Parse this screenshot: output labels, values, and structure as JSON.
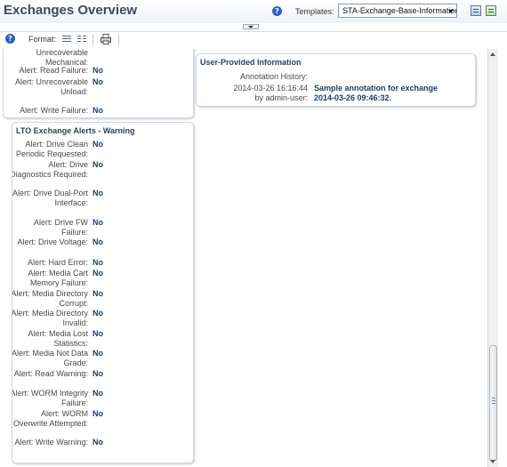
{
  "header": {
    "title": "Exchanges Overview",
    "templates_label": "Templates:",
    "template_value": "STA-Exchange-Base-Information",
    "help_glyph": "?"
  },
  "toolbar": {
    "help_glyph": "?",
    "format_label": "Format:"
  },
  "panels": {
    "top_left": {
      "rows": [
        {
          "label": "Unrecoverable Mechanical:",
          "value": ""
        },
        {
          "label": "Alert: Read Failure:",
          "value": "No"
        },
        {
          "label": "Alert: Unrecoverable Unload:",
          "value": "No"
        },
        {
          "label": "Alert: Write Failure:",
          "value": "No"
        }
      ]
    },
    "user_info": {
      "title": "User-Provided Information",
      "history_label": "Annotation History:",
      "entry_label": "2014-03-26 16:16:44 by admin-user:",
      "entry_value": "Sample annotation for exchange 2014-03-26 09:46:32."
    },
    "lto_warning": {
      "title": "LTO Exchange Alerts - Warning",
      "rows": [
        {
          "label": "Alert: Drive Clean Periodic Requested:",
          "value": "No"
        },
        {
          "label": "Alert: Drive Diagnostics Required:",
          "value": "No"
        },
        {
          "label": "Alert: Drive Dual-Port Interface:",
          "value": "No"
        },
        {
          "label": "Alert: Drive FW Failure:",
          "value": "No"
        },
        {
          "label": "Alert: Drive Voltage:",
          "value": "No"
        },
        {
          "label": "Alert: Hard Error:",
          "value": "No"
        },
        {
          "label": "Alert: Media Cart Memory Failure:",
          "value": "No"
        },
        {
          "label": "Alert: Media Directory Corrupt:",
          "value": "No"
        },
        {
          "label": "Alert: Media Directory Invalid:",
          "value": "No"
        },
        {
          "label": "Alert: Media Lost Statistics:",
          "value": "No"
        },
        {
          "label": "Alert: Media Not Data Grade:",
          "value": "No"
        },
        {
          "label": "Alert: Read Warning:",
          "value": "No"
        },
        {
          "label": "Alert: WORM Integrity Failure:",
          "value": "No"
        },
        {
          "label": "Alert: WORM Overwrite Attempted:",
          "value": "No"
        },
        {
          "label": "Alert: Write Warning:",
          "value": "No"
        }
      ]
    }
  }
}
